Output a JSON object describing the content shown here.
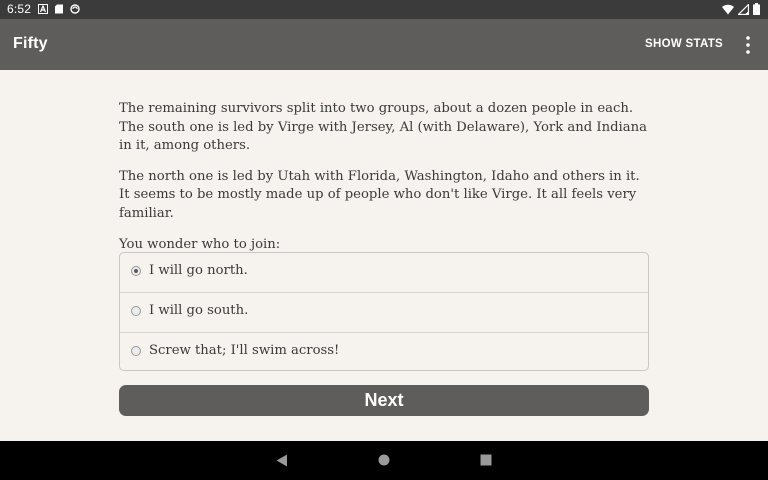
{
  "status_bar": {
    "time": "6:52",
    "left_icons": [
      "a-icon",
      "sd-card-icon",
      "sync-icon"
    ],
    "right_icons": [
      "wifi-icon",
      "signal-icon",
      "battery-icon"
    ]
  },
  "app_bar": {
    "title": "Fifty",
    "show_stats_label": "SHOW STATS",
    "overflow_icon": "more-vert-icon"
  },
  "story": {
    "paragraphs": [
      "The remaining survivors split into two groups, about a dozen people in each. The south one is led by Virge with Jersey, Al (with Delaware), York and Indiana in it, among others.",
      "The north one is led by Utah with Florida, Washington, Idaho and others in it. It seems to be mostly made up of people who don't like Virge. It all feels very familiar.",
      "You wonder who to join:"
    ]
  },
  "choices": [
    {
      "label": "I will go north.",
      "selected": true
    },
    {
      "label": "I will go south.",
      "selected": false
    },
    {
      "label": "Screw that; I'll swim across!",
      "selected": false
    }
  ],
  "next_button": {
    "label": "Next"
  },
  "nav_bar": {
    "buttons": [
      "back-icon",
      "home-icon",
      "recents-icon"
    ]
  },
  "colors": {
    "app_bar": "#5f5d5c",
    "background": "#f6f2ee",
    "status_bar": "#3b3b3b",
    "nav_bar": "#000000"
  }
}
